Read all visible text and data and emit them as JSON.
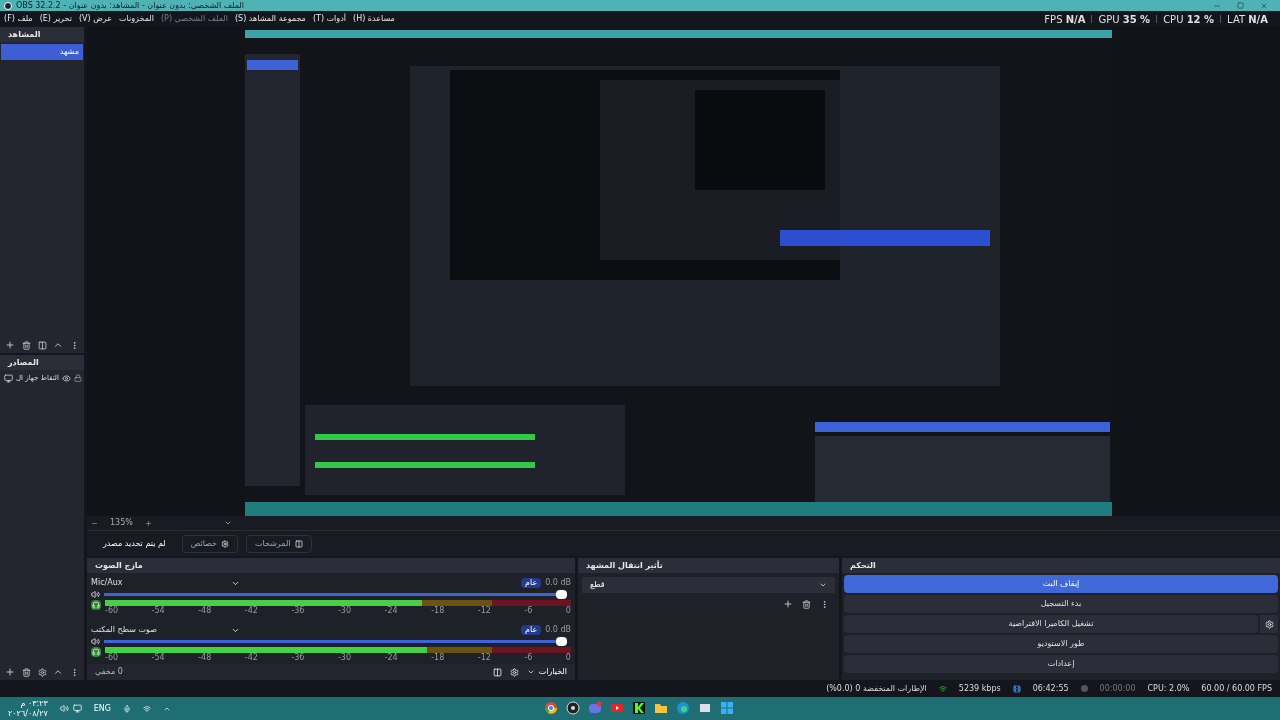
{
  "window": {
    "title": "الملف الشخصي: بدون عنوان - المشاهد: بدون عنوان - OBS 32.2.2"
  },
  "menu": [
    {
      "label": "مساعدة (H)",
      "disabled": false
    },
    {
      "label": "أدوات (T)",
      "disabled": false
    },
    {
      "label": "مجموعة المشاهد (S)",
      "disabled": false
    },
    {
      "label": "الملف الشخصي (P)",
      "disabled": true
    },
    {
      "label": "المخزونات",
      "disabled": false
    },
    {
      "label": "عرض (V)",
      "disabled": false
    },
    {
      "label": "تحرير (E)",
      "disabled": false
    },
    {
      "label": "ملف (F)",
      "disabled": false
    }
  ],
  "stats": [
    "LAT **N/A**",
    "CPU **12 %**",
    "GPU **35 %**",
    "FPS **N/A**"
  ],
  "scenes": {
    "title": "المشاهد",
    "items": [
      {
        "label": "مشهد",
        "selected": true
      }
    ]
  },
  "sources": {
    "title": "المصادر",
    "items": [
      {
        "label": "التقاط جهاز ال",
        "visible": true,
        "locked": true
      }
    ]
  },
  "preview": {
    "kind": "picture"
  },
  "zoom": {
    "value": "135%"
  },
  "source_toolbar": {
    "buttons": [
      {
        "label": "المرشحات",
        "kind": "filters"
      },
      {
        "label": "خصائص",
        "kind": "properties"
      }
    ],
    "status": "لم يتم تحديد مصدر"
  },
  "mixer": {
    "title": "مازج الصوت",
    "hidden": "0 مخفي",
    "options": "الخيارات",
    "channels": [
      {
        "name": "Mic/Aux",
        "badge": "عام",
        "reading": "0.0 dB",
        "muted": false,
        "volume": {
          "level": 1
        },
        "meter": {
          "level": 0.68
        },
        "scale": [
          "0",
          "-6",
          "-12",
          "-18",
          "-24",
          "-30",
          "-36",
          "-42",
          "-48",
          "-54",
          "-60"
        ]
      },
      {
        "name": "صوت سطح المكتب",
        "badge": "عام",
        "reading": "0.0 dB",
        "muted": false,
        "volume": {
          "level": 1
        },
        "meter": {
          "level": 0.69
        },
        "scale": [
          "0",
          "-6",
          "-12",
          "-18",
          "-24",
          "-30",
          "-36",
          "-42",
          "-48",
          "-54",
          "-60"
        ]
      }
    ]
  },
  "transitions": {
    "title": "تأثير انتقال المشهد",
    "value": "قطع"
  },
  "controls": {
    "title": "التحكم",
    "buttons": [
      {
        "label": "إيقاف البث",
        "kind": "plain",
        "active": true
      },
      {
        "label": "بدء التسجيل",
        "kind": "plain",
        "active": false
      },
      {
        "label": "تشغيل الكاميرا الافتراضية",
        "kind": "virtualcam",
        "active": false
      },
      {
        "label": "طور الاستوديو",
        "kind": "plain",
        "active": false
      },
      {
        "label": "إعدادات",
        "kind": "plain",
        "active": false
      }
    ]
  },
  "status_bar": {
    "dropped": "الإطارات المنخفضة 0 (0.0%)",
    "bitrate": "5239 kbps",
    "stream_time": "06:42:55",
    "record_time": "00:00:00",
    "cpu": "CPU: 2.0%",
    "fps": "60.00 / 60.00 FPS"
  },
  "taskbar": {
    "time": "٠٣:٢٣ م",
    "date": "٢٠٢٦/٠٨/٢٧",
    "language": "ENG"
  }
}
